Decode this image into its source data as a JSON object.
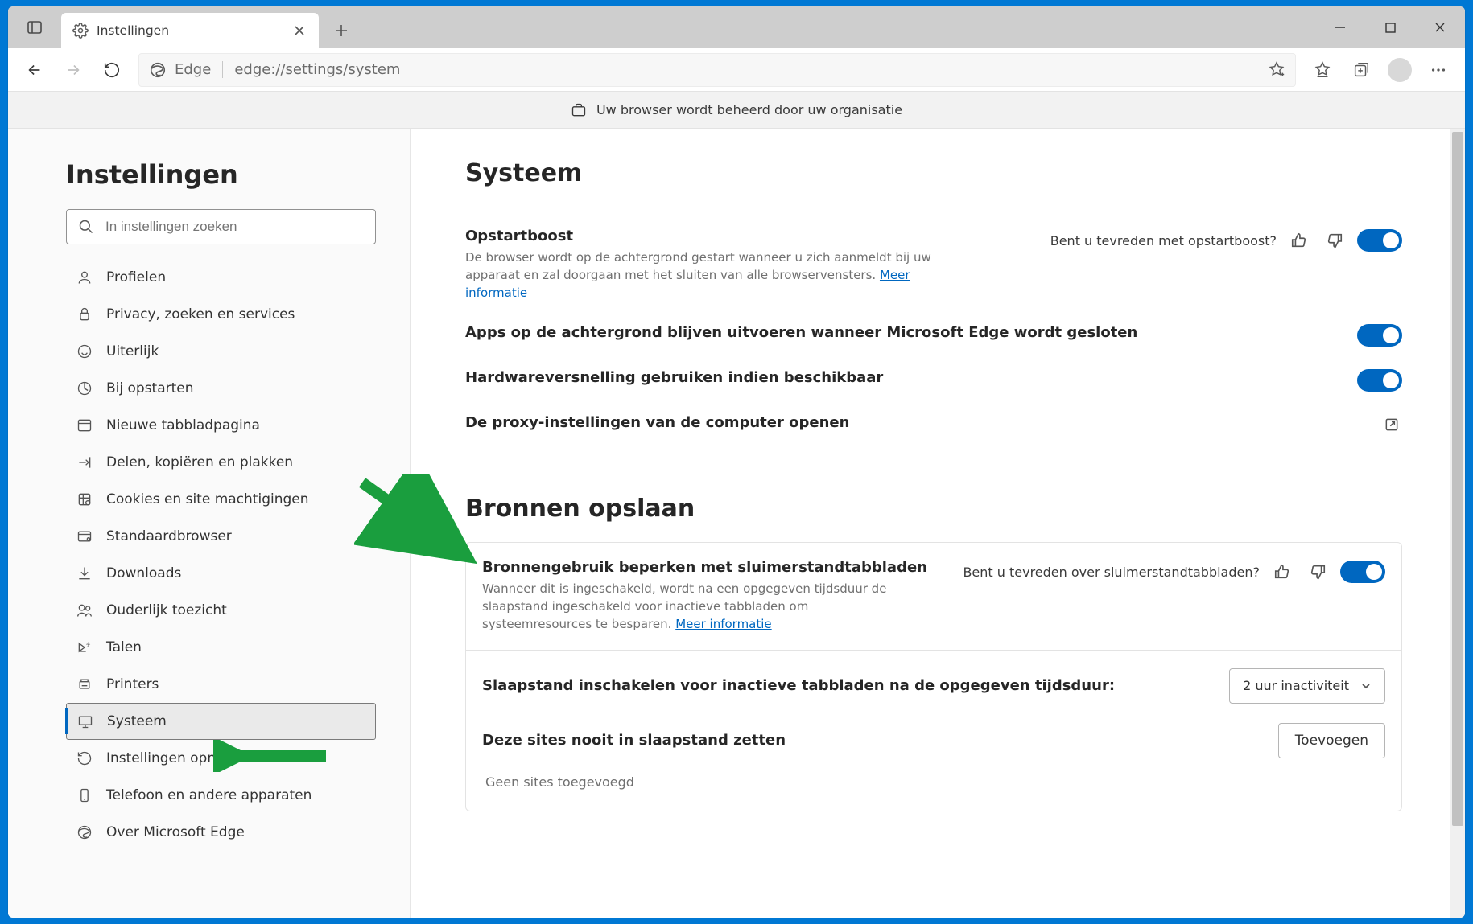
{
  "tab": {
    "title": "Instellingen"
  },
  "address": {
    "prefix": "Edge",
    "url": "edge://settings/system"
  },
  "org_banner": "Uw browser wordt beheerd door uw organisatie",
  "sidebar": {
    "heading": "Instellingen",
    "search_placeholder": "In instellingen zoeken",
    "items": [
      {
        "label": "Profielen"
      },
      {
        "label": "Privacy, zoeken en services"
      },
      {
        "label": "Uiterlijk"
      },
      {
        "label": "Bij opstarten"
      },
      {
        "label": "Nieuwe tabbladpagina"
      },
      {
        "label": "Delen, kopiëren en plakken"
      },
      {
        "label": "Cookies en site machtigingen"
      },
      {
        "label": "Standaardbrowser"
      },
      {
        "label": "Downloads"
      },
      {
        "label": "Ouderlijk toezicht"
      },
      {
        "label": "Talen"
      },
      {
        "label": "Printers"
      },
      {
        "label": "Systeem"
      },
      {
        "label": "Instellingen opnieuw instellen"
      },
      {
        "label": "Telefoon en andere apparaten"
      },
      {
        "label": "Over Microsoft Edge"
      }
    ],
    "selected_index": 12
  },
  "main": {
    "heading1": "Systeem",
    "startup_boost": {
      "title": "Opstartboost",
      "desc": "De browser wordt op de achtergrond gestart wanneer u zich aanmeldt bij uw apparaat en zal doorgaan met het sluiten van alle browservensters.",
      "learn_more": "Meer informatie",
      "feedback_q": "Bent u tevreden met opstartboost?"
    },
    "background_apps": {
      "title": "Apps op de achtergrond blijven uitvoeren wanneer Microsoft Edge wordt gesloten"
    },
    "hw_accel": {
      "title": "Hardwareversnelling gebruiken indien beschikbaar"
    },
    "proxy": {
      "title": "De proxy-instellingen van de computer openen"
    },
    "heading2": "Bronnen opslaan",
    "sleep_tabs": {
      "title": "Bronnengebruik beperken met sluimerstandtabbladen",
      "desc": "Wanneer dit is ingeschakeld, wordt na een opgegeven tijdsduur de slaapstand ingeschakeld voor inactieve tabbladen om systeemresources te besparen.",
      "learn_more": "Meer informatie",
      "feedback_q": "Bent u tevreden over sluimerstandtabbladen?"
    },
    "sleep_after": {
      "label": "Slaapstand inschakelen voor inactieve tabbladen na de opgegeven tijdsduur:",
      "value": "2 uur inactiviteit"
    },
    "never_sleep": {
      "label": "Deze sites nooit in slaapstand zetten",
      "add": "Toevoegen",
      "empty": "Geen sites toegevoegd"
    }
  }
}
